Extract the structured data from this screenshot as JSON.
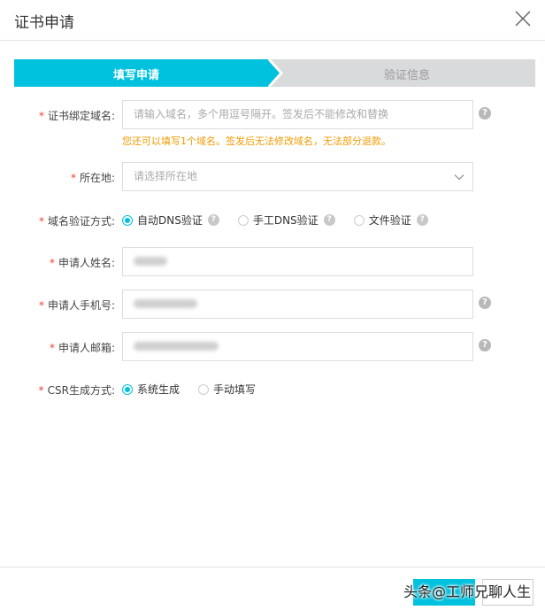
{
  "dialog": {
    "title": "证书申请"
  },
  "steps": [
    {
      "label": "填写申请",
      "active": true
    },
    {
      "label": "验证信息",
      "active": false
    }
  ],
  "form": {
    "required_mark": "*",
    "domain": {
      "label": "证书绑定域名:",
      "placeholder": "请输入域名，多个用逗号隔开。签发后不能修改和替换",
      "notice": "您还可以填写1个域名。签发后无法修改域名，无法部分退款。"
    },
    "location": {
      "label": "所在地:",
      "placeholder": "请选择所在地"
    },
    "verify": {
      "label": "域名验证方式:",
      "options": [
        {
          "label": "自动DNS验证",
          "selected": true
        },
        {
          "label": "手工DNS验证",
          "selected": false
        },
        {
          "label": "文件验证",
          "selected": false
        }
      ]
    },
    "name": {
      "label": "申请人姓名:"
    },
    "phone": {
      "label": "申请人手机号:"
    },
    "email": {
      "label": "申请人邮箱:"
    },
    "csr": {
      "label": "CSR生成方式:",
      "options": [
        {
          "label": "系统生成",
          "selected": true
        },
        {
          "label": "手动填写",
          "selected": false
        }
      ]
    }
  },
  "help_glyph": "?",
  "watermark": "头条@工师兄聊人生",
  "colors": {
    "accent": "#00c1de",
    "warning": "#f09b00",
    "required": "#f04134",
    "step_inactive": "#d9dadc"
  }
}
